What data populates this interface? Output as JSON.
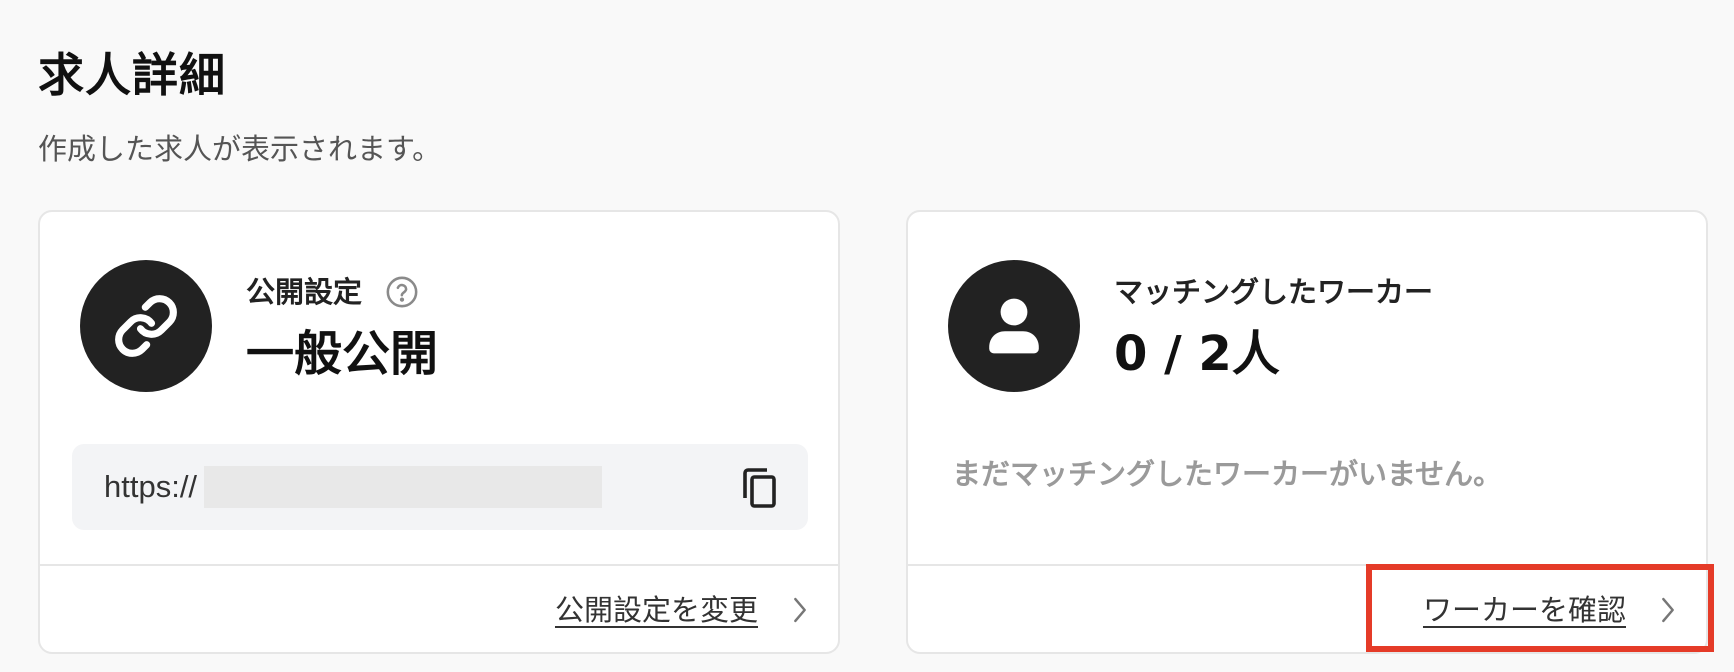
{
  "page": {
    "title": "求人詳細",
    "subtitle": "作成した求人が表示されます。"
  },
  "publish_card": {
    "icon": "link-icon",
    "label": "公開設定",
    "help_icon": "help-circle-icon",
    "value": "一般公開",
    "url_prefix": "https://",
    "copy_icon": "copy-icon",
    "footer_link": "公開設定を変更",
    "footer_icon": "chevron-right-icon"
  },
  "matching_card": {
    "icon": "user-icon",
    "label": "マッチングしたワーカー",
    "value": "0 / 2人",
    "empty_message": "まだマッチングしたワーカーがいません。",
    "footer_link": "ワーカーを確認",
    "footer_icon": "chevron-right-icon"
  },
  "colors": {
    "background": "#f9f9f9",
    "card_background": "#ffffff",
    "icon_circle": "#222222",
    "highlight": "#e53b28"
  }
}
